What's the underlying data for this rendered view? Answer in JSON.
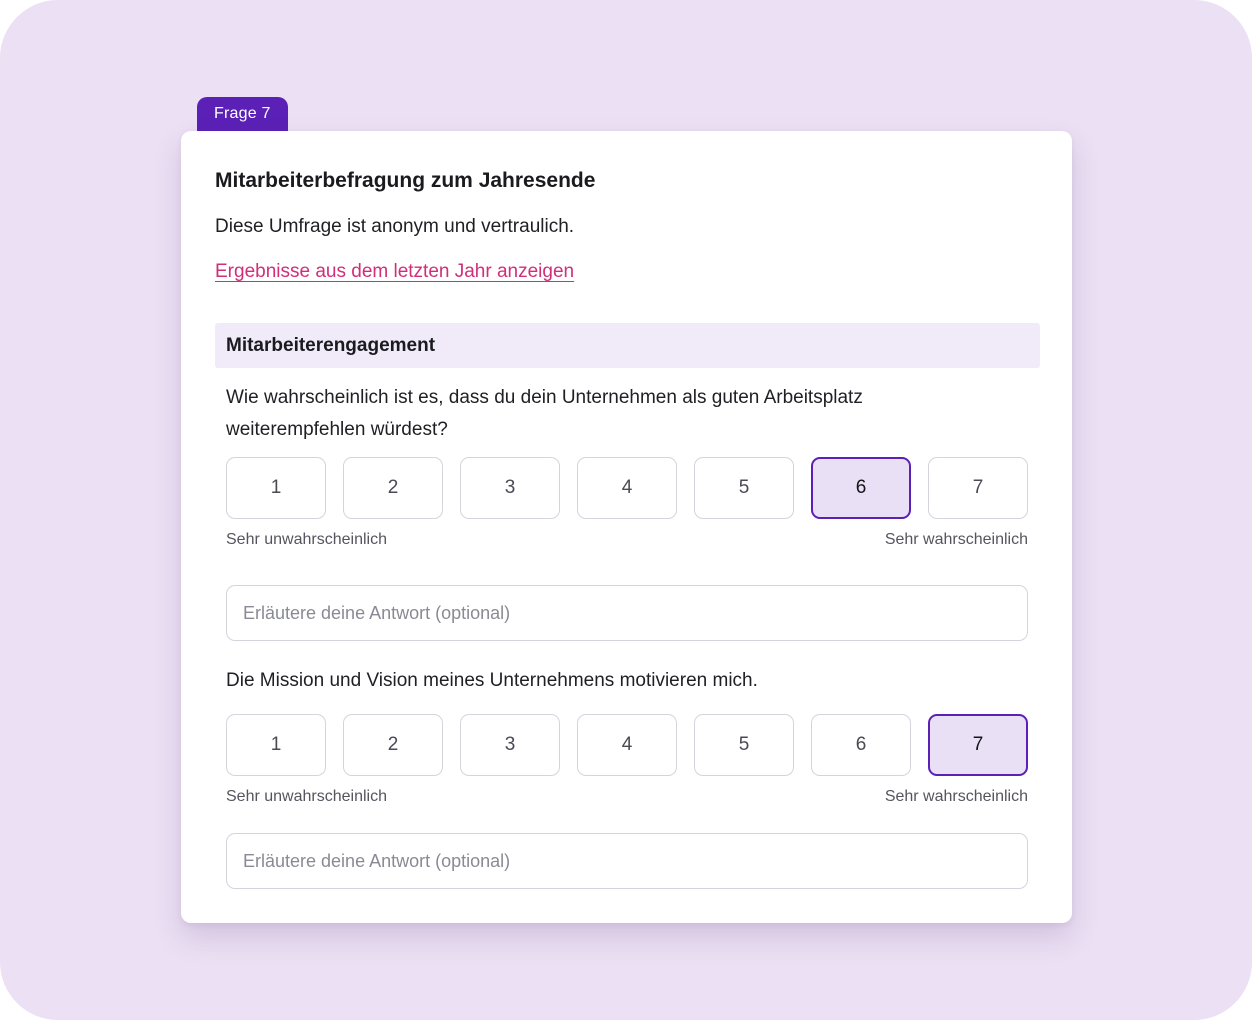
{
  "badge": "Frage 7",
  "survey": {
    "title": "Mitarbeiterbefragung zum Jahresende",
    "subtitle": "Diese Umfrage ist anonym und vertraulich.",
    "results_link": "Ergebnisse aus dem letzten Jahr anzeigen"
  },
  "section": {
    "title": "Mitarbeiterengagement"
  },
  "questions": [
    {
      "text": "Wie wahrscheinlich ist es, dass du dein Unternehmen als guten Arbeitsplatz weiterempfehlen würdest?",
      "options": [
        "1",
        "2",
        "3",
        "4",
        "5",
        "6",
        "7"
      ],
      "selected": "6",
      "min_label": "Sehr unwahrscheinlich",
      "max_label": "Sehr wahrscheinlich",
      "comment_placeholder": "Erläutere deine Antwort (optional)"
    },
    {
      "text": "Die Mission und Vision meines Unternehmens motivieren mich.",
      "options": [
        "1",
        "2",
        "3",
        "4",
        "5",
        "6",
        "7"
      ],
      "selected": "7",
      "min_label": "Sehr unwahrscheinlich",
      "max_label": "Sehr wahrscheinlich",
      "comment_placeholder": "Erläutere deine Antwort (optional)"
    }
  ],
  "colors": {
    "accent": "#5b21b6",
    "selected_fill": "#e9e0f6",
    "link": "#d12e7a",
    "background": "#ece0f4",
    "section_fill": "#f1eaf8"
  }
}
